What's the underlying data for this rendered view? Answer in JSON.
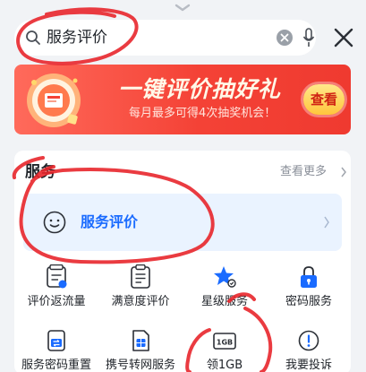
{
  "search": {
    "query": "服务评价"
  },
  "banner": {
    "title": "一键评价抽好礼",
    "subtitle": "每月最多可得4次抽奖机会！",
    "button_label": "查看"
  },
  "services": {
    "title": "服务",
    "more_label": "查看更多",
    "highlight": {
      "label": "服务评价",
      "icon": "smile-icon"
    },
    "items": [
      {
        "label": "评价返流量",
        "icon": "return-icon"
      },
      {
        "label": "满意度评价",
        "icon": "clipboard-icon"
      },
      {
        "label": "星级服务",
        "icon": "star-icon"
      },
      {
        "label": "密码服务",
        "icon": "lock-icon"
      },
      {
        "label": "服务密码重置",
        "icon": "reset-icon"
      },
      {
        "label": "携号转网服务",
        "icon": "sim-icon"
      },
      {
        "label": "领1GB",
        "icon": "data-gift-icon"
      },
      {
        "label": "我要投诉",
        "icon": "complaint-icon"
      }
    ],
    "data_gift_badge": "1GB"
  },
  "colors": {
    "accent": "#1a6bff",
    "banner_red": "#f44236",
    "annotation_red": "#e8262c"
  }
}
